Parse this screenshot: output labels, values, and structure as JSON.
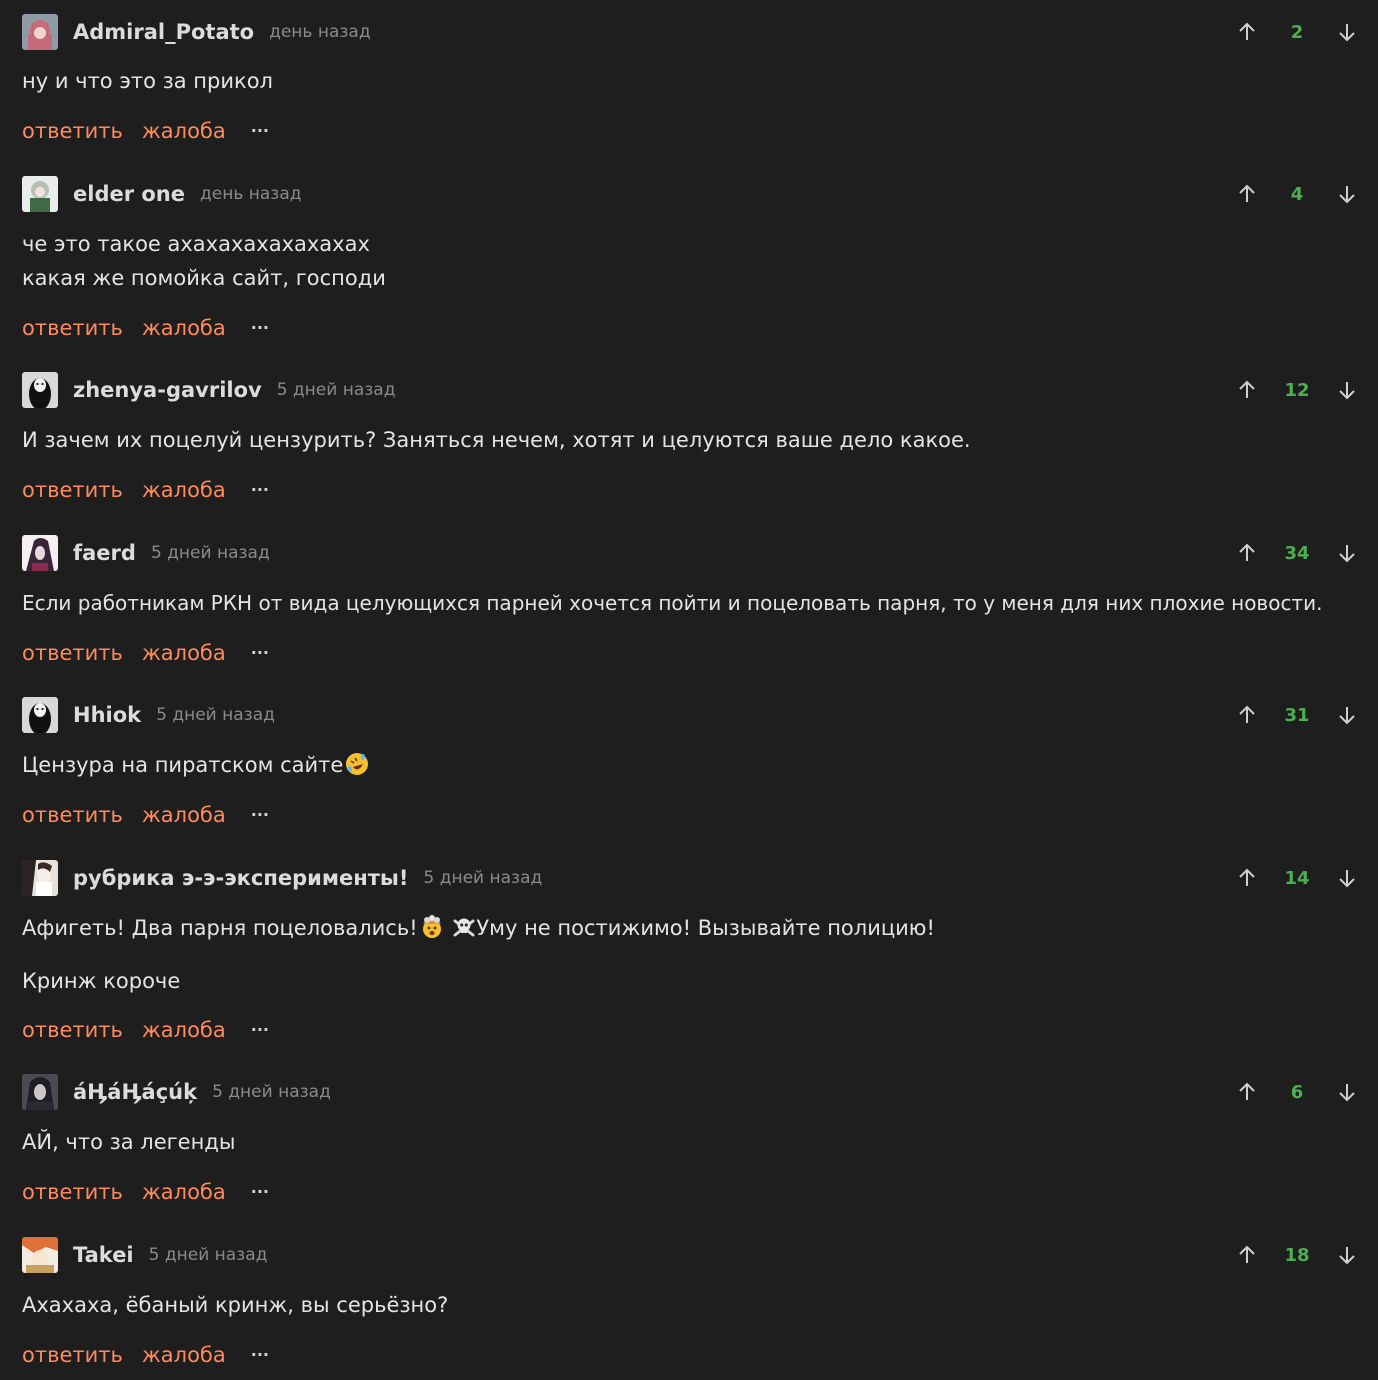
{
  "actions": {
    "reply": "ответить",
    "report": "жалоба",
    "more": "···"
  },
  "comments": [
    {
      "username": "Admiral_Potato",
      "time": "день назад",
      "score": "2",
      "lines": [
        "ну и что это за прикол"
      ],
      "avatar_color": "#c46a7a"
    },
    {
      "username": "elder one",
      "time": "день назад",
      "score": "4",
      "lines": [
        "че это такое ахахахахахахахах",
        "какая же помойка сайт, господи"
      ],
      "avatar_color": "#8aa38a"
    },
    {
      "username": "zhenya-gavrilov",
      "time": "5 дней назад",
      "score": "12",
      "lines": [
        "И зачем их поцелуй цензурить? Заняться нечем, хотят и целуются ваше дело какое."
      ],
      "avatar_color": "#d8d8d8"
    },
    {
      "username": "faerd",
      "time": "5 дней назад",
      "score": "34",
      "lines": [
        "Если работникам РКН от вида целующихся парней хочется пойти и поцеловать парня, то у меня для них плохие новости."
      ],
      "avatar_color": "#5a3b5e"
    },
    {
      "username": "Hhiok",
      "time": "5 дней назад",
      "score": "31",
      "lines": [
        "Цензура на пиратском сайте"
      ],
      "avatar_color": "#d8d8d8"
    },
    {
      "username": "рубрика э-э-эксперименты!",
      "time": "5 дней назад",
      "score": "14",
      "lines": [
        "Афигеть! Два парня поцеловались!",
        "Уму не постижимо! Вызывайте полицию!",
        "Кринж короче"
      ],
      "avatar_color": "#e8e2dc"
    },
    {
      "username": "áӉáӉáçúķ",
      "time": "5 дней назад",
      "score": "6",
      "lines": [
        "АЙ, что за легенды"
      ],
      "avatar_color": "#3a3a44"
    },
    {
      "username": "Takei",
      "time": "5 дней назад",
      "score": "18",
      "lines": [
        "Ахахаха, ёбаный кринж, вы серьёзно?"
      ],
      "avatar_color": "#e0703a"
    }
  ],
  "colors": {
    "background": "#1e1e1e",
    "accent_link": "#ff8a5c",
    "score_positive": "#4caf50",
    "muted_text": "#8a8a8a"
  },
  "icons": {
    "upvote": "arrow-up-icon",
    "downvote": "arrow-down-icon",
    "emoji_rofl": "rofl-emoji",
    "emoji_exploding": "exploding-head-emoji",
    "emoji_skull": "skull-crossbones-emoji"
  }
}
